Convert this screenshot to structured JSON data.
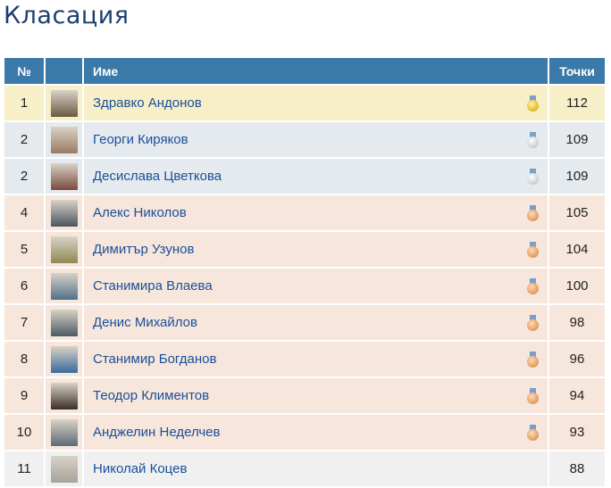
{
  "page": {
    "title": "Класация"
  },
  "table": {
    "headers": {
      "rank": "№",
      "avatar": "",
      "name": "Име",
      "points": "Точки"
    },
    "rows": [
      {
        "rank": "1",
        "name": "Здравко Андонов",
        "points": "112",
        "medal": "gold",
        "avatar_color": "#6b5a43"
      },
      {
        "rank": "2",
        "name": "Георги Киряков",
        "points": "109",
        "medal": "silver",
        "avatar_color": "#9c7a63"
      },
      {
        "rank": "2",
        "name": "Десислава Цветкова",
        "points": "109",
        "medal": "silver",
        "avatar_color": "#7a4a3e"
      },
      {
        "rank": "4",
        "name": "Алекс Николов",
        "points": "105",
        "medal": "bronze",
        "avatar_color": "#4a5560"
      },
      {
        "rank": "5",
        "name": "Димитър Узунов",
        "points": "104",
        "medal": "bronze",
        "avatar_color": "#8d8a52"
      },
      {
        "rank": "6",
        "name": "Станимира Влаева",
        "points": "100",
        "medal": "bronze",
        "avatar_color": "#52708a"
      },
      {
        "rank": "7",
        "name": "Денис Михайлов",
        "points": "98",
        "medal": "bronze",
        "avatar_color": "#4c5a66"
      },
      {
        "rank": "8",
        "name": "Станимир Богданов",
        "points": "96",
        "medal": "bronze",
        "avatar_color": "#3a6a9c"
      },
      {
        "rank": "9",
        "name": "Теодор Климентов",
        "points": "94",
        "medal": "bronze",
        "avatar_color": "#3b2f2a"
      },
      {
        "rank": "10",
        "name": "Анджелин Неделчев",
        "points": "93",
        "medal": "bronze",
        "avatar_color": "#5a6a74"
      },
      {
        "rank": "11",
        "name": "Николай Коцев",
        "points": "88",
        "medal": "none",
        "avatar_color": "#a6a39a"
      }
    ]
  },
  "colors": {
    "header_bg": "#3b79a8",
    "gold_row": "#f7efc8",
    "silver_row": "#e5eaee",
    "bronze_row": "#f6e6db",
    "plain_row": "#f0f0f0",
    "link": "#1a4f9a"
  }
}
